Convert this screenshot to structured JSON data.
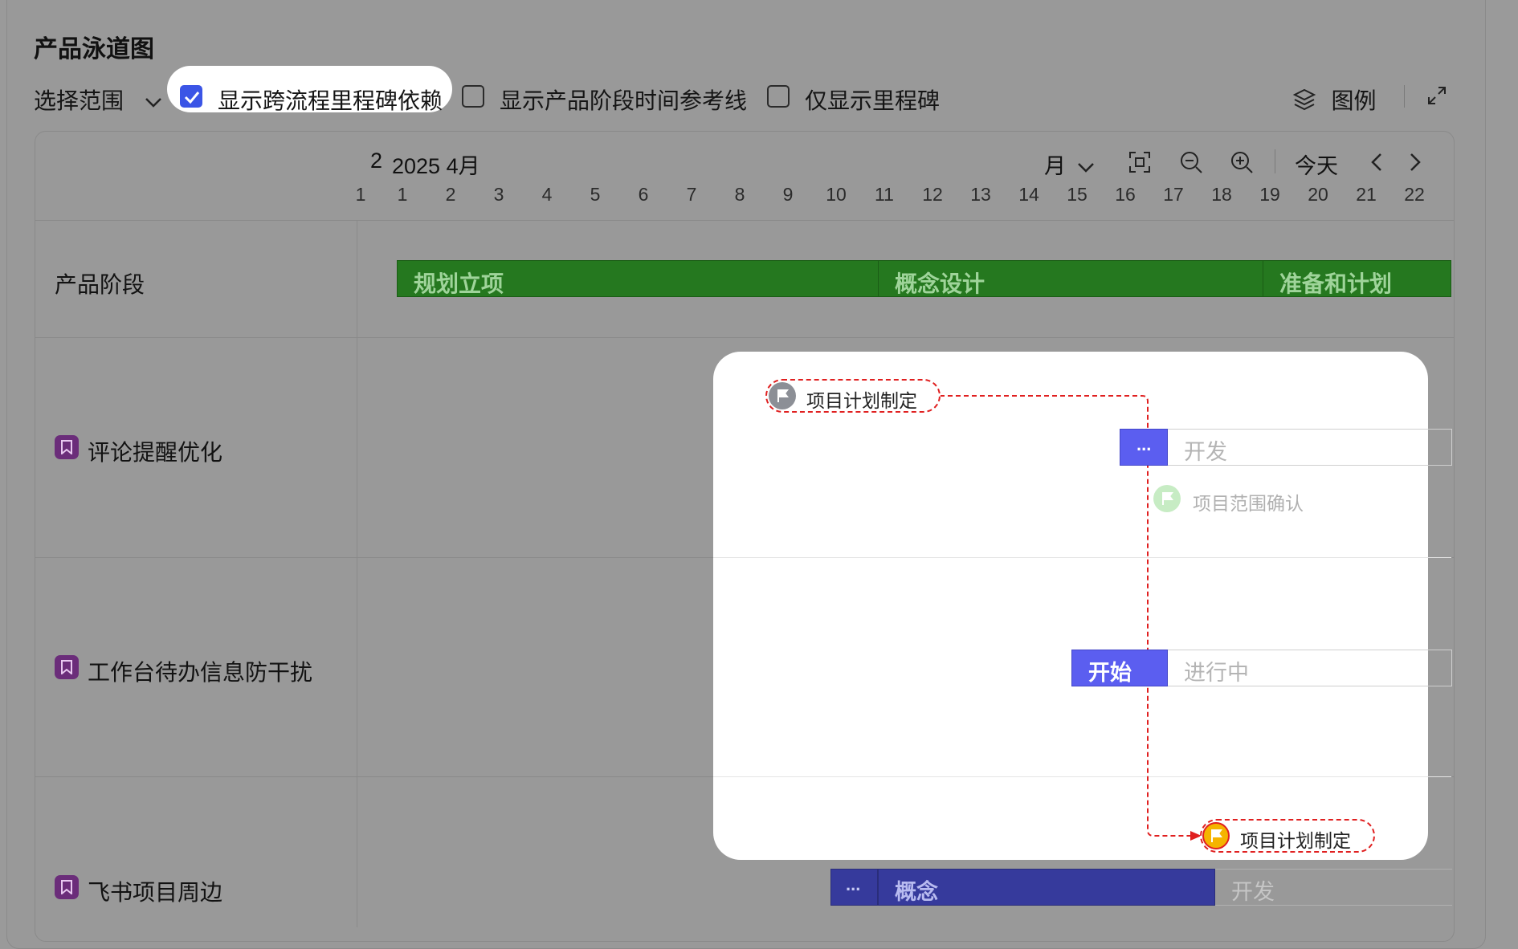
{
  "header": {
    "title": "产品泳道图",
    "scope_label": "选择范围",
    "options": [
      {
        "label": "显示跨流程里程碑依赖",
        "checked": true
      },
      {
        "label": "显示产品阶段时间参考线",
        "checked": false
      },
      {
        "label": "仅显示里程碑",
        "checked": false
      }
    ],
    "legend_label": "图例"
  },
  "timeline": {
    "prev_partial_month": "2",
    "month_label": "2025 4月",
    "view_mode": "月",
    "today_label": "今天",
    "days": [
      "1",
      "1",
      "2",
      "3",
      "4",
      "5",
      "6",
      "7",
      "8",
      "9",
      "10",
      "11",
      "12",
      "13",
      "14",
      "15",
      "16",
      "17",
      "18",
      "19",
      "20",
      "21",
      "22"
    ]
  },
  "rows": {
    "phase_row_label": "产品阶段",
    "phases": [
      "规划立项",
      "概念设计",
      "准备和计划"
    ],
    "lanes": [
      {
        "label": "评论提醒优化"
      },
      {
        "label": "工作台待办信息防干扰"
      },
      {
        "label": "飞书项目周边"
      }
    ]
  },
  "lane1": {
    "milestone_source": "项目计划制定",
    "stage_short": "...",
    "stage_next": "开发",
    "milestone_faded": "项目范围确认"
  },
  "lane2": {
    "stage_start": "开始",
    "stage_next": "进行中"
  },
  "lane3": {
    "milestone_target": "项目计划制定",
    "stage_short": "...",
    "stage_main": "概念",
    "stage_next": "开发"
  },
  "colors": {
    "accent": "#3b55e6",
    "phase_green": "#25781f",
    "stage_blue": "#5b5ef0",
    "stage_dark_blue": "#363a9c",
    "dependency_red": "#e02020",
    "milestone_yellow": "#f5b400",
    "lane_tag_purple": "#6b2d7a"
  }
}
